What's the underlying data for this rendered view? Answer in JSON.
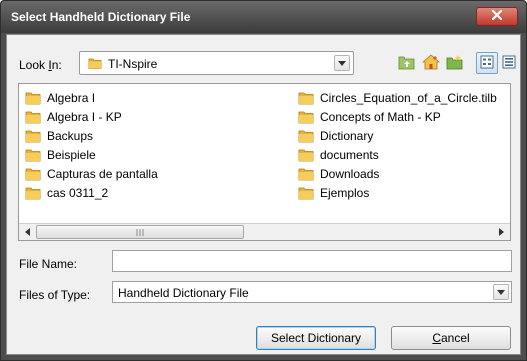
{
  "window": {
    "title": "Select Handheld Dictionary File",
    "close_icon": "close-icon",
    "accent_color": "#c0392b"
  },
  "lookin": {
    "label_prefix": "Look ",
    "label_mnemonic": "I",
    "label_suffix": "n:",
    "value": "TI-Nspire",
    "folder_icon": "folder-icon"
  },
  "toolbar": {
    "buttons": [
      {
        "name": "up-folder-icon"
      },
      {
        "name": "home-icon"
      },
      {
        "name": "new-folder-icon"
      },
      {
        "name": "list-view-icon",
        "active": true
      },
      {
        "name": "details-view-icon"
      }
    ]
  },
  "files": {
    "left": [
      {
        "label": "Algebra I"
      },
      {
        "label": "Algebra I - KP"
      },
      {
        "label": "Backups"
      },
      {
        "label": "Beispiele"
      },
      {
        "label": "Capturas de pantalla"
      },
      {
        "label": "cas 0311_2"
      }
    ],
    "right": [
      {
        "label": "Circles_Equation_of_a_Circle.tilb"
      },
      {
        "label": "Concepts of Math - KP"
      },
      {
        "label": "Dictionary"
      },
      {
        "label": "documents"
      },
      {
        "label": "Downloads"
      },
      {
        "label": "Ejemplos"
      }
    ]
  },
  "file_name": {
    "label": "File Name:",
    "value": ""
  },
  "file_type": {
    "label": "Files of Type:",
    "value": "Handheld Dictionary File"
  },
  "buttons": {
    "select_label": "Select Dictionary",
    "cancel_mnemonic": "C",
    "cancel_rest": "ancel"
  }
}
